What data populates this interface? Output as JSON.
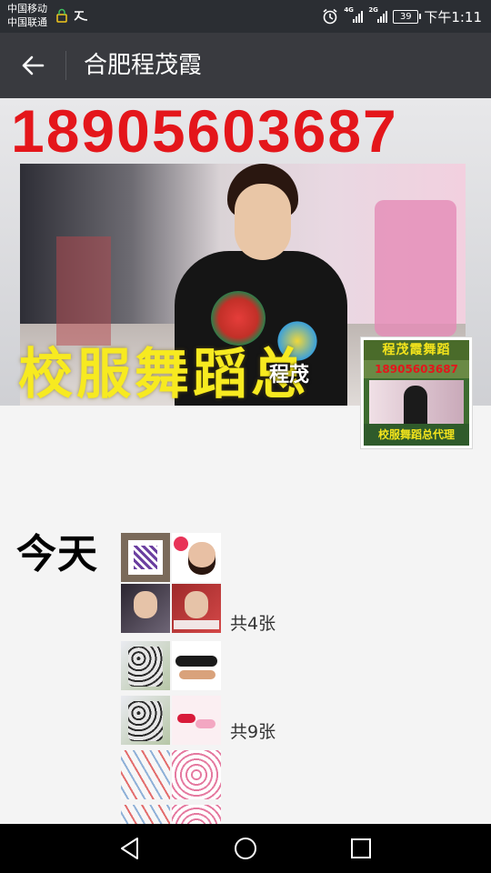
{
  "status_bar": {
    "carrier1": "中国移动",
    "carrier2": "中国联通",
    "signal1_label": "4G",
    "signal2_label": "2G",
    "battery": "39",
    "time": "下午1:11",
    "icons": [
      "lock-icon",
      "wechat-sport-icon",
      "alarm-icon",
      "signal-icon",
      "battery-icon"
    ]
  },
  "header": {
    "back_icon": "arrow-left-icon",
    "title": "合肥程茂霞"
  },
  "cover": {
    "phone_text": "18905603687",
    "slogan": "校服舞蹈总",
    "name_overlay": "程茂"
  },
  "avatar": {
    "top_text": "程茂霞舞蹈",
    "phone_text": "18905603687",
    "bottom_text": "校服舞蹈总代理"
  },
  "timeline": {
    "day_label": "今天",
    "posts": [
      {
        "count_label": "共4张",
        "thumbs": [
          "qr-code",
          "woman-hearts",
          "woman-portrait",
          "woman-red-banner"
        ]
      },
      {
        "count_label": "共9张",
        "thumbs": [
          "printed-shirt",
          "dance-shoes",
          "printed-shirt",
          "pink-shoes",
          "printed-fabric",
          "floral-fabric",
          "floral-top",
          "floral-top"
        ]
      }
    ]
  },
  "nav_bar": {
    "icons": [
      "back-triangle-icon",
      "home-circle-icon",
      "recents-square-icon"
    ]
  },
  "colors": {
    "status_bar": "#2b2e33",
    "title_bar": "#393a3f",
    "phone_red": "#e4161b",
    "slogan_yellow": "#f7ea20",
    "background": "#f4f4f4"
  }
}
